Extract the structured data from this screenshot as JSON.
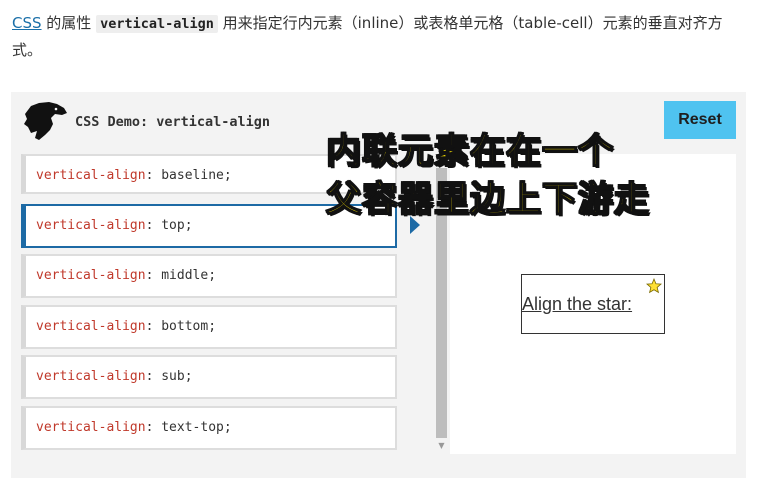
{
  "intro": {
    "link": "CSS",
    "text_before_code": " 的属性 ",
    "code": "vertical-align",
    "text_after_code": " 用来指定行内元素（inline）或表格单元格（table-cell）元素的垂直对齐方式。"
  },
  "demo": {
    "title": "CSS Demo: vertical-align",
    "reset_label": "Reset",
    "choices": [
      {
        "prop": "vertical-align",
        "value": "baseline;"
      },
      {
        "prop": "vertical-align",
        "value": "top;"
      },
      {
        "prop": "vertical-align",
        "value": "middle;"
      },
      {
        "prop": "vertical-align",
        "value": "bottom;"
      },
      {
        "prop": "vertical-align",
        "value": "sub;"
      },
      {
        "prop": "vertical-align",
        "value": "text-top;"
      }
    ],
    "selected_value": "top;",
    "output_text": "Align the star: "
  },
  "overlay": {
    "line1": "内联元素在在一个",
    "line2": "父容器里边上下游走"
  },
  "colors": {
    "accent": "#1d6aa5",
    "reset_bg": "#4fc3f0",
    "property": "#c0392b",
    "overlay_text": "#ffe600"
  },
  "icons": [
    "dinosaur-logo-icon",
    "star-icon",
    "scroll-up-arrow-icon",
    "scroll-down-arrow-icon",
    "selected-arrow-icon"
  ]
}
